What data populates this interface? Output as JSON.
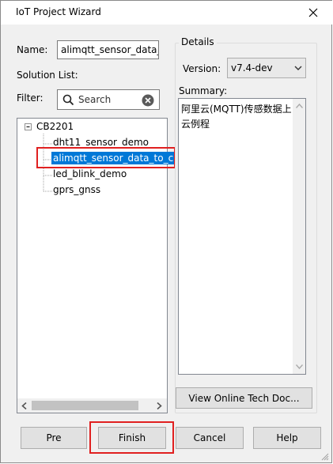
{
  "window": {
    "title": "IoT Project Wizard",
    "close_icon": "close-icon"
  },
  "form": {
    "name_label": "Name:",
    "name_value": "alimqtt_sensor_data_t",
    "solution_list_label": "Solution List:",
    "filter_label": "Filter:",
    "filter_placeholder": "Search"
  },
  "tree": {
    "root": "CB2201",
    "items": [
      "dht11_sensor_demo",
      "alimqtt_sensor_data_to_c",
      "led_blink_demo",
      "gprs_gnss"
    ],
    "selected_index": 1
  },
  "details": {
    "group_title": "Details",
    "version_label": "Version:",
    "version_value": "v7.4-dev",
    "summary_label": "Summary:",
    "summary_text": "阿里云(MQTT)传感数据上云例程",
    "view_docs_button": "View Online Tech Doc..."
  },
  "buttons": {
    "pre": "Pre",
    "finish": "Finish",
    "cancel": "Cancel",
    "help": "Help"
  },
  "colors": {
    "selection": "#0078d7",
    "highlight_box": "#e02020"
  }
}
